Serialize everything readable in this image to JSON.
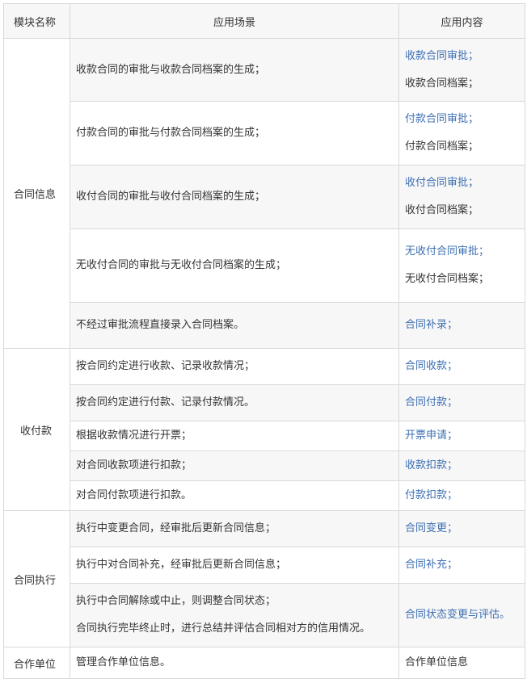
{
  "headers": [
    "模块名称",
    "应用场景",
    "应用内容"
  ],
  "groups": {
    "contract_info": "合同信息",
    "payments": "收付款",
    "execution": "合同执行",
    "partner": "合作单位"
  },
  "rows": [
    {
      "scene": [
        "收款合同的审批与收款合同档案的生成；"
      ],
      "content": [
        {
          "text": "收款合同审批；",
          "link": true
        },
        {
          "text": "收款合同档案；",
          "link": false
        }
      ]
    },
    {
      "scene": [
        "付款合同的审批与付款合同档案的生成；"
      ],
      "content": [
        {
          "text": "付款合同审批；",
          "link": true
        },
        {
          "text": "付款合同档案；",
          "link": false
        }
      ]
    },
    {
      "scene": [
        "收付合同的审批与收付合同档案的生成；"
      ],
      "content": [
        {
          "text": "收付合同审批；",
          "link": true
        },
        {
          "text": "收付合同档案；",
          "link": false
        }
      ]
    },
    {
      "scene": [
        "无收付合同的审批与无收付合同档案的生成；"
      ],
      "content": [
        {
          "text": "无收付合同审批；",
          "link": true
        },
        {
          "text": "无收付合同档案；",
          "link": false
        }
      ]
    },
    {
      "scene": [
        "不经过审批流程直接录入合同档案。"
      ],
      "content": [
        {
          "text": "合同补录；",
          "link": true
        }
      ]
    },
    {
      "scene": [
        "按合同约定进行收款、记录收款情况；"
      ],
      "content": [
        {
          "text": "合同收款；",
          "link": true
        }
      ]
    },
    {
      "scene": [
        "按合同约定进行付款、记录付款情况。"
      ],
      "content": [
        {
          "text": "合同付款；",
          "link": true
        }
      ]
    },
    {
      "scene": [
        "根据收款情况进行开票；"
      ],
      "content": [
        {
          "text": "开票申请；",
          "link": true
        }
      ]
    },
    {
      "scene": [
        "对合同收款项进行扣款；"
      ],
      "content": [
        {
          "text": "收款扣款；",
          "link": true
        }
      ]
    },
    {
      "scene": [
        "对合同付款项进行扣款。"
      ],
      "content": [
        {
          "text": "付款扣款；",
          "link": true
        }
      ]
    },
    {
      "scene": [
        "执行中变更合同，经审批后更新合同信息；"
      ],
      "content": [
        {
          "text": "合同变更；",
          "link": true
        }
      ]
    },
    {
      "scene": [
        "执行中对合同补充，经审批后更新合同信息；"
      ],
      "content": [
        {
          "text": "合同补充；",
          "link": true
        }
      ]
    },
    {
      "scene": [
        "执行中合同解除或中止，则调整合同状态；",
        "合同执行完毕终止时，进行总结并评估合同相对方的信用情况。"
      ],
      "content": [
        {
          "text": "合同状态变更与评估。",
          "link": true
        }
      ]
    },
    {
      "scene": [
        "管理合作单位信息。"
      ],
      "content": [
        {
          "text": "合作单位信息",
          "link": false
        }
      ]
    }
  ]
}
